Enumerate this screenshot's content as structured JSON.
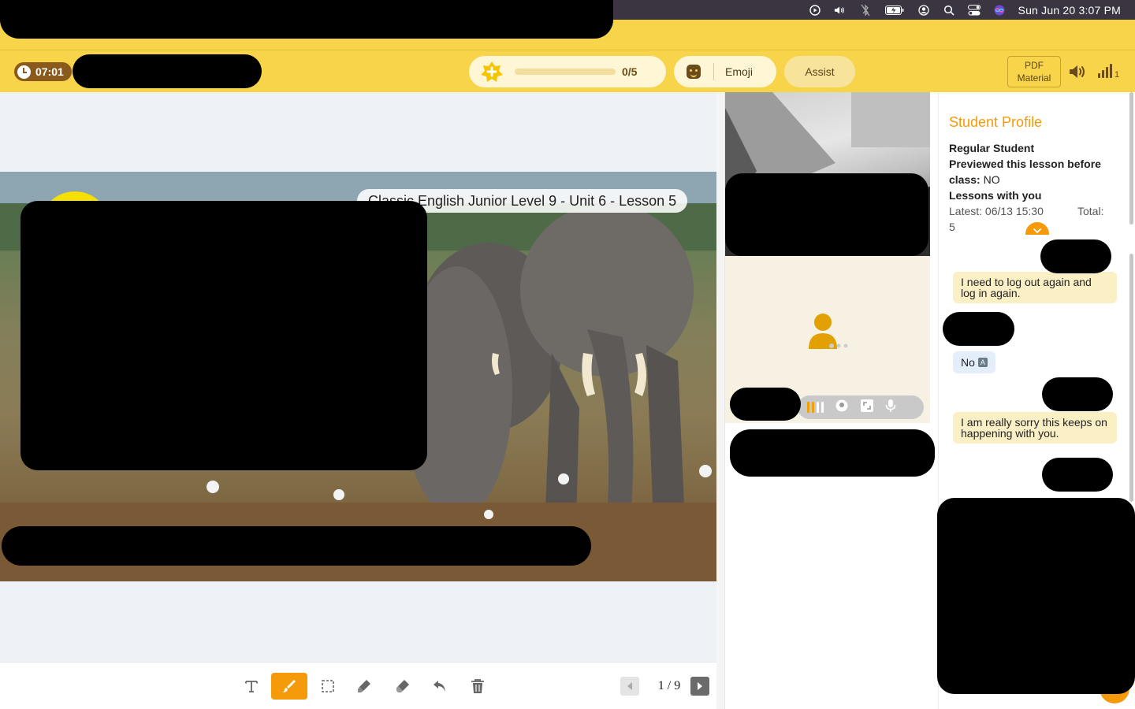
{
  "menubar": {
    "datetime": "Sun Jun 20  3:07 PM",
    "icons": [
      "play-circle-icon",
      "volume-icon",
      "bluetooth-icon",
      "battery-icon",
      "user-icon",
      "search-icon",
      "control-center-icon",
      "siri-icon"
    ]
  },
  "toolbar": {
    "timer": "07:01",
    "stars_count": "0/5",
    "stars_progress": 0,
    "emoji_label": "Emoji",
    "assist_label": "Assist",
    "pdf_line1": "PDF",
    "pdf_line2": "Material",
    "signal_value": "1"
  },
  "board": {
    "slide_title": "Classic English Junior Level 9 - Unit 6 - Lesson 5",
    "tools": [
      "text-tool",
      "brush-tool",
      "select-tool",
      "highlighter-tool",
      "eraser-tool",
      "undo-tool",
      "delete-tool"
    ],
    "active_tool": "brush-tool",
    "page": "1 / 9"
  },
  "profile": {
    "title": "Student Profile",
    "type": "Regular Student",
    "previewed_label": "Previewed this lesson before",
    "previewed_class": "class:",
    "previewed_value": "NO",
    "lessons_label": "Lessons with you",
    "latest": "Latest: 06/13 15:30",
    "total_label": "Total:",
    "total_value": "5"
  },
  "chat": {
    "messages": [
      {
        "side": "out",
        "text": "I need to log out again and log in again."
      },
      {
        "side": "in",
        "text": "No"
      },
      {
        "side": "out",
        "text": "I am really sorry this keeps on happening with you."
      }
    ]
  },
  "colors": {
    "toolbar_bg": "#f8d44a",
    "accent": "#f59a0a",
    "brown": "#8a5a1c"
  }
}
